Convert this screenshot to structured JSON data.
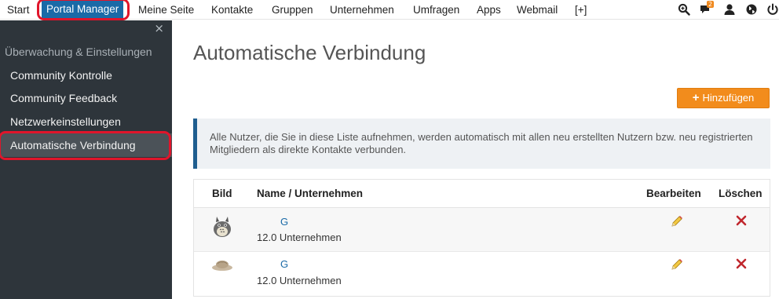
{
  "topnav": {
    "items": [
      "Start",
      "Portal Manager",
      "Meine Seite",
      "Kontakte",
      "Gruppen",
      "Unternehmen",
      "Umfragen",
      "Apps",
      "Webmail",
      "[+]"
    ],
    "notification_count": "2",
    "icons": [
      "search-zoom-icon",
      "chat-bubble-icon",
      "user-icon",
      "globe-icon",
      "power-icon"
    ]
  },
  "sidebar": {
    "close_symbol": "×",
    "section_title": "Überwachung & Einstellungen",
    "items": [
      "Community Kontrolle",
      "Community Feedback",
      "Netzwerkeinstellungen",
      "Automatische Verbindung"
    ]
  },
  "main": {
    "title": "Automatische Verbindung",
    "add_button": "Hinzufügen",
    "info": "Alle Nutzer, die Sie in diese Liste aufnehmen, werden automatisch mit allen neu erstellten Nutzern bzw. neu registrierten Mitgliedern als direkte Kontakte verbunden."
  },
  "table": {
    "headers": [
      "Bild",
      "Name / Unternehmen",
      "Bearbeiten",
      "Löschen"
    ],
    "rows": [
      {
        "name": "G",
        "company": "12.0 Unternehmen",
        "avatar": "totoro-avatar"
      },
      {
        "name": "G",
        "company": "12.0 Unternehmen",
        "avatar": "hat-avatar"
      }
    ]
  },
  "colors": {
    "accent_blue": "#1a6aa7",
    "sidebar_bg": "#2e353b",
    "button_orange": "#f28c1c",
    "highlight_red": "#e0152b",
    "delete_red": "#c0272d"
  }
}
